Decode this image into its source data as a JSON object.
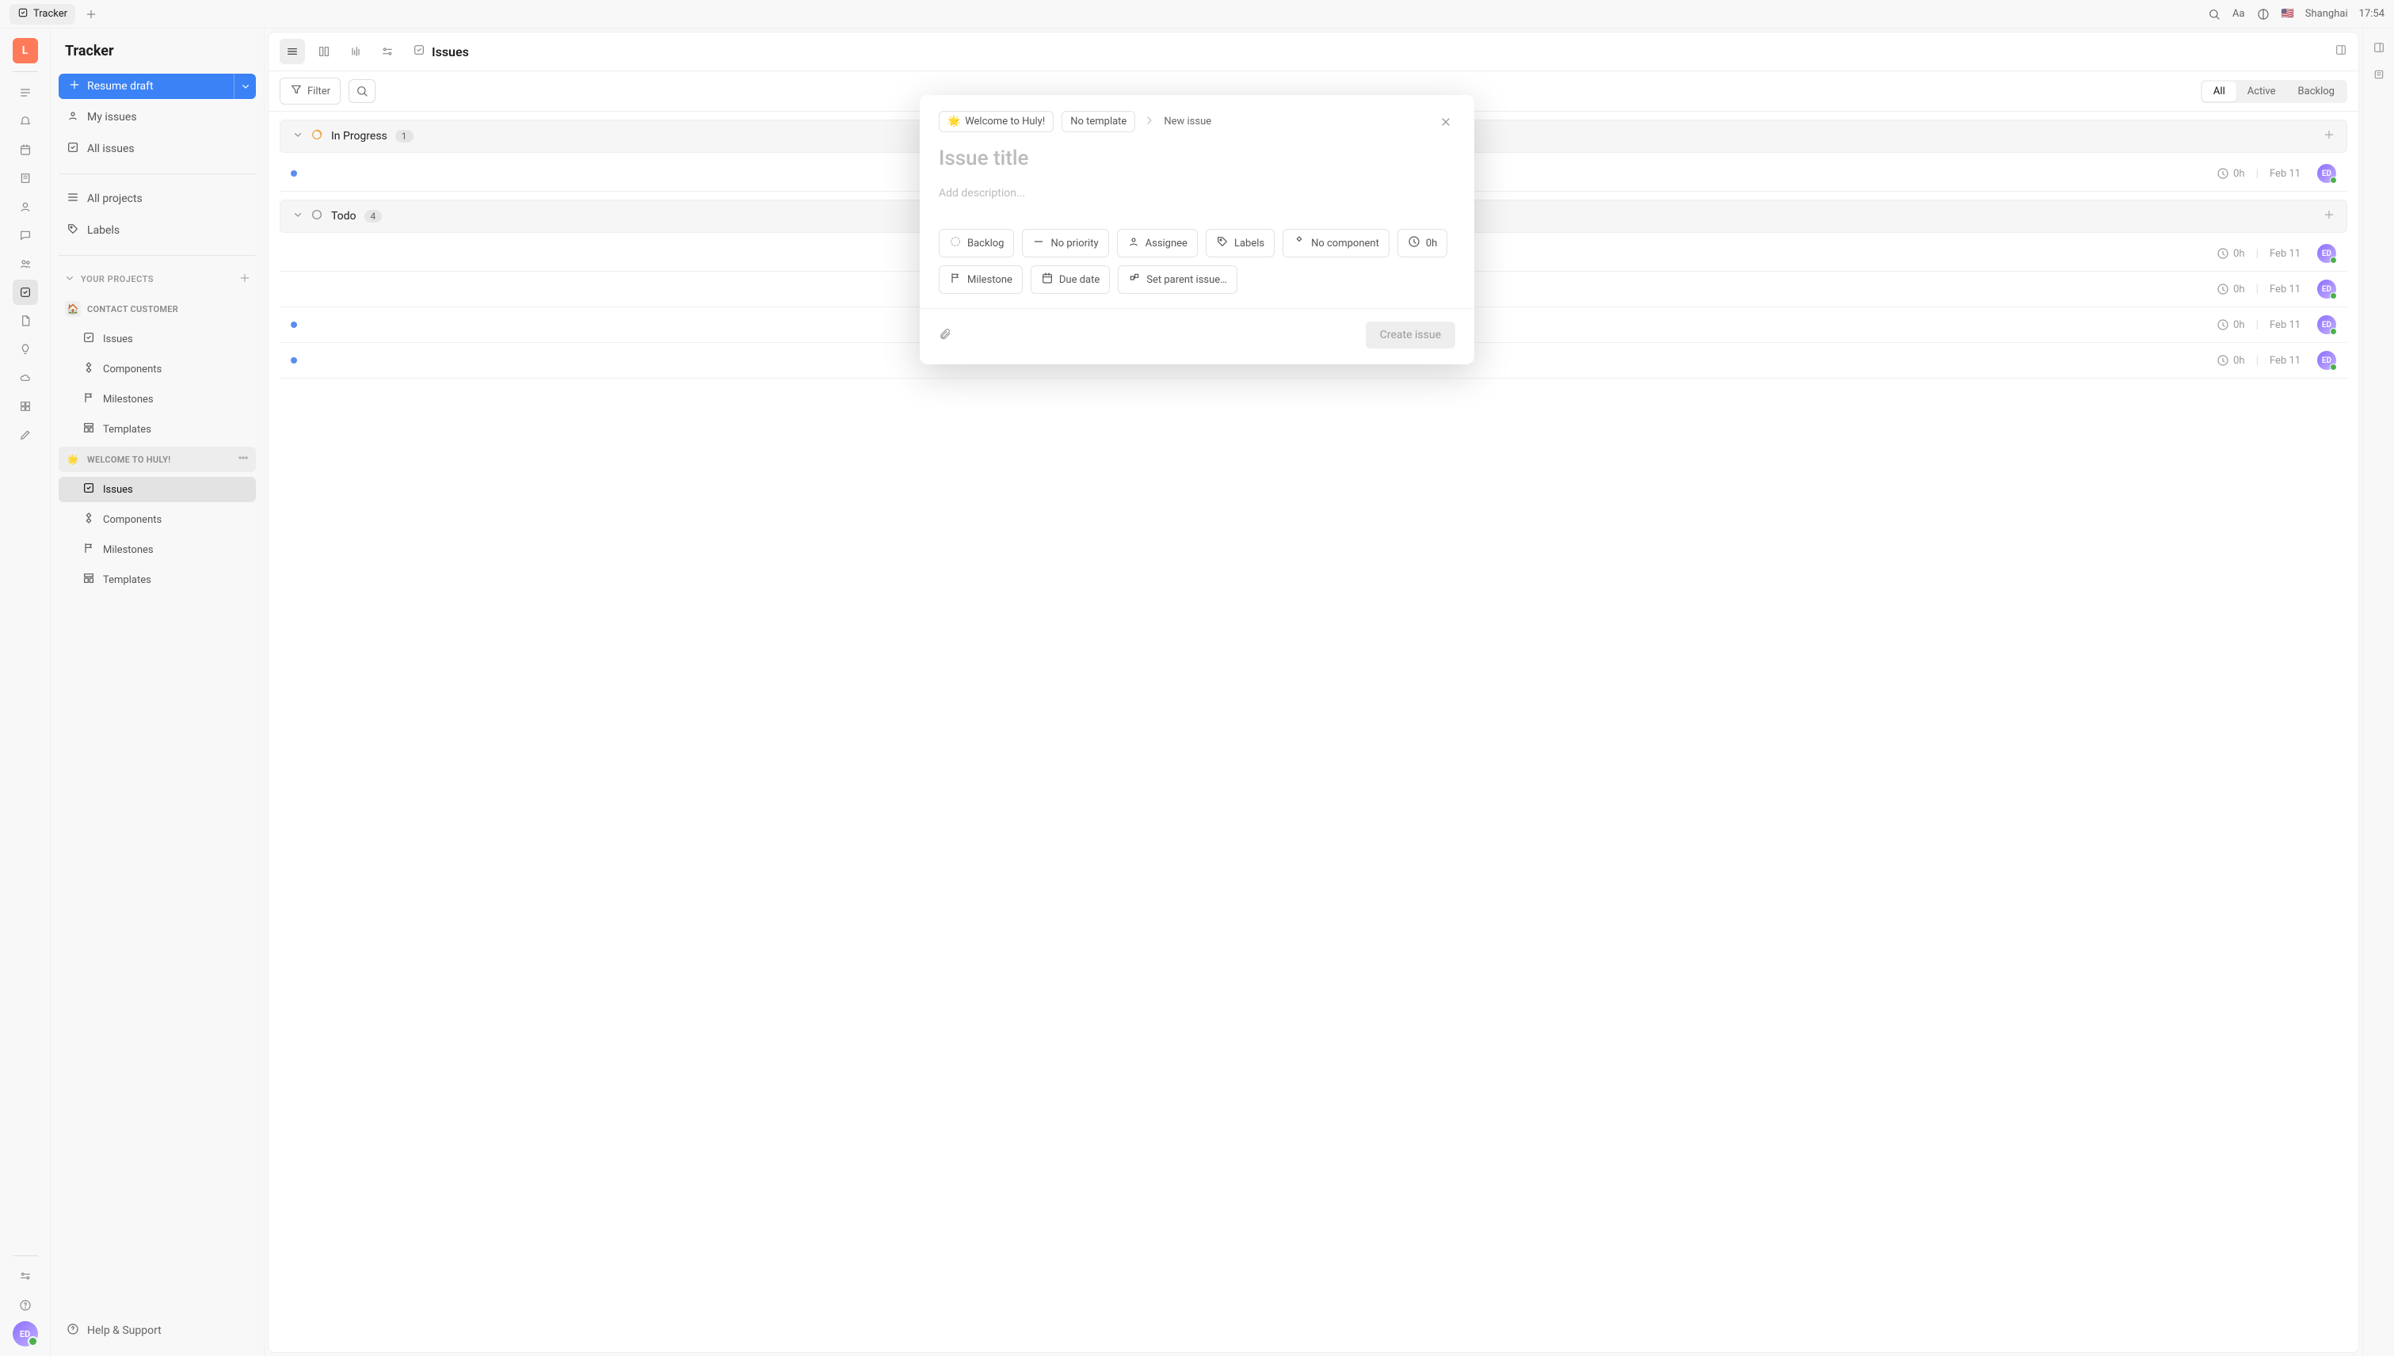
{
  "topbar": {
    "tab_label": "Tracker",
    "font_label": "Aa",
    "flag": "🇺🇸",
    "location": "Shanghai",
    "time": "17:54"
  },
  "rail": {
    "logo_letter": "L",
    "avatar_initials": "ED"
  },
  "sidebar": {
    "title": "Tracker",
    "new_button": "Resume draft",
    "my_issues": "My issues",
    "all_issues": "All issues",
    "all_projects": "All projects",
    "labels": "Labels",
    "section_your_projects": "YOUR PROJECTS",
    "proj_contact": {
      "emoji": "🏠",
      "name": "CONTACT CUSTOMER",
      "issues": "Issues",
      "components": "Components",
      "milestones": "Milestones",
      "templates": "Templates"
    },
    "proj_welcome": {
      "emoji": "🌟",
      "name": "WELCOME TO HULY!",
      "issues": "Issues",
      "components": "Components",
      "milestones": "Milestones",
      "templates": "Templates"
    },
    "help": "Help & Support"
  },
  "content": {
    "title": "Issues",
    "filter": "Filter",
    "tabs": {
      "all": "All",
      "active": "Active",
      "backlog": "Backlog"
    },
    "groups": [
      {
        "label": "In Progress",
        "count": "1"
      },
      {
        "label": "Todo",
        "count": "4"
      }
    ],
    "rows_est": "0h",
    "rows_date": "Feb 11",
    "rows_avatar": "ED"
  },
  "modal": {
    "crumb_project_emoji": "🌟",
    "crumb_project": "Welcome to Huly!",
    "crumb_template": "No template",
    "crumb_new": "New issue",
    "title_placeholder": "Issue title",
    "desc_placeholder": "Add description...",
    "chips": {
      "backlog": "Backlog",
      "priority": "No priority",
      "assignee": "Assignee",
      "labels": "Labels",
      "component": "No component",
      "est": "0h",
      "milestone": "Milestone",
      "due": "Due date",
      "parent": "Set parent issue…"
    },
    "create": "Create issue"
  }
}
